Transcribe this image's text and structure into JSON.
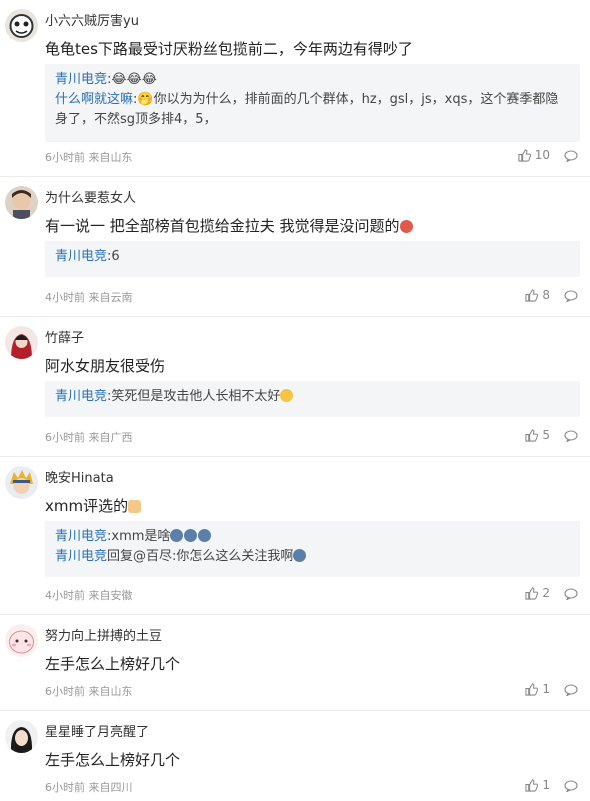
{
  "comments": [
    {
      "username": "小六六贼厉害yu",
      "text": "龟龟tes下路最受讨厌粉丝包揽前二，今年两边有得吵了",
      "replies": [
        {
          "name": "青川电竞",
          "text": ":😂😂😂"
        },
        {
          "name": "什么啊就这嘛",
          "text": ":🤭你以为为什么，排前面的几个群体，hz，gsl，js，xqs，这个赛季都隐身了，不然sg顶多排4，5，"
        }
      ],
      "time": "6小时前",
      "location": "来自山东",
      "likes": "10"
    },
    {
      "username": "为什么要惹女人",
      "text": "有一说一 把全部榜首包揽给金拉夫 我觉得是没问题的",
      "replies": [
        {
          "name": "青川电竞",
          "text": ":6"
        }
      ],
      "time": "4小时前",
      "location": "来自云南",
      "likes": "8"
    },
    {
      "username": "竹薛子",
      "text": "阿水女朋友很受伤",
      "replies": [
        {
          "name": "青川电竞",
          "text": ":笑死但是攻击他人长相不太好"
        }
      ],
      "time": "6小时前",
      "location": "来自广西",
      "likes": "5"
    },
    {
      "username": "晚安Hinata",
      "text": "xmm评选的",
      "replies": [
        {
          "name": "青川电竞",
          "text": ":xmm是啥"
        },
        {
          "name": "青川电竞",
          "text": "回复@百尽:你怎么这么关注我啊"
        }
      ],
      "time": "4小时前",
      "location": "来自安徽",
      "likes": "2"
    },
    {
      "username": "努力向上拼搏的土豆",
      "text": "左手怎么上榜好几个",
      "replies": [],
      "time": "6小时前",
      "location": "来自山东",
      "likes": "1"
    },
    {
      "username": "星星睡了月亮醒了",
      "text": "左手怎么上榜好几个",
      "replies": [],
      "time": "6小时前",
      "location": "来自四川",
      "likes": "1"
    }
  ],
  "colors": {
    "reply_name": "#2a6fb5",
    "meta": "#999999",
    "reply_bg": "#f4f5f7"
  },
  "icons": {
    "like": "thumbs-up-icon",
    "reply": "speech-bubble-icon"
  }
}
